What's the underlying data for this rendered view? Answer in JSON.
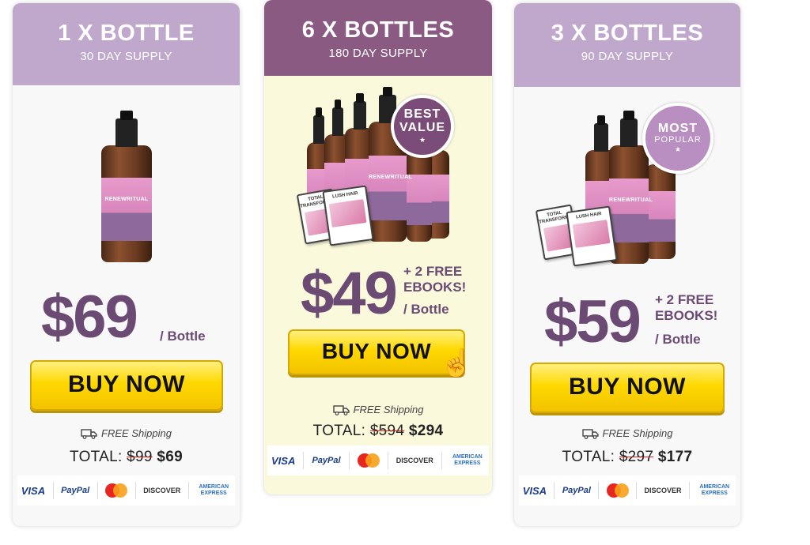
{
  "colors": {
    "accent_purple": "#6b4a73",
    "head_light": "#c0a8cc",
    "head_dark": "#8a5a82",
    "buy_yellow": "#ffd800",
    "featured_bg": "#fbf9dc"
  },
  "cards": [
    {
      "title": "1 X BOTTLE",
      "subtitle": "30 DAY SUPPLY",
      "price": "$69",
      "price_unit": "/ Bottle",
      "bonus_line1": "",
      "bonus_line2": "",
      "buy_label": "BUY NOW",
      "shipping": "FREE Shipping",
      "total_label": "TOTAL:",
      "old_price": "$99",
      "new_price": "$69",
      "brand": "RENEWRITUAL"
    },
    {
      "title": "6 X BOTTLES",
      "subtitle": "180 DAY SUPPLY",
      "seal_line1": "BEST",
      "seal_line2": "VALUE",
      "seal_star": "★",
      "price": "$49",
      "bonus_line1": "+ 2 FREE",
      "bonus_line2": "EBOOKS!",
      "price_unit": "/ Bottle",
      "buy_label": "BUY NOW",
      "shipping": "FREE Shipping",
      "total_label": "TOTAL:",
      "old_price": "$594",
      "new_price": "$294",
      "ebook_total": "TOTAL TRANSFORMATION",
      "ebook_lush": "LUSH HAIR",
      "brand": "RENEWRITUAL"
    },
    {
      "title": "3 X BOTTLES",
      "subtitle": "90 DAY SUPPLY",
      "seal_line1": "MOST",
      "seal_line2": "POPULAR",
      "seal_star": "★",
      "price": "$59",
      "bonus_line1": "+ 2 FREE",
      "bonus_line2": "EBOOKS!",
      "price_unit": "/ Bottle",
      "buy_label": "BUY NOW",
      "shipping": "FREE Shipping",
      "total_label": "TOTAL:",
      "old_price": "$297",
      "new_price": "$177",
      "ebook_total": "TOTAL TRANSFORMATION",
      "ebook_lush": "LUSH HAIR",
      "brand": "RENEWRITUAL"
    }
  ],
  "payments": {
    "visa": "VISA",
    "paypal": "PayPal",
    "mastercard": "MasterCard",
    "discover": "DISCOVER",
    "amex": "AMERICAN EXPRESS"
  },
  "icons": {
    "truck": "truck-icon",
    "cursor": "hand-cursor-icon",
    "star": "star-icon"
  }
}
